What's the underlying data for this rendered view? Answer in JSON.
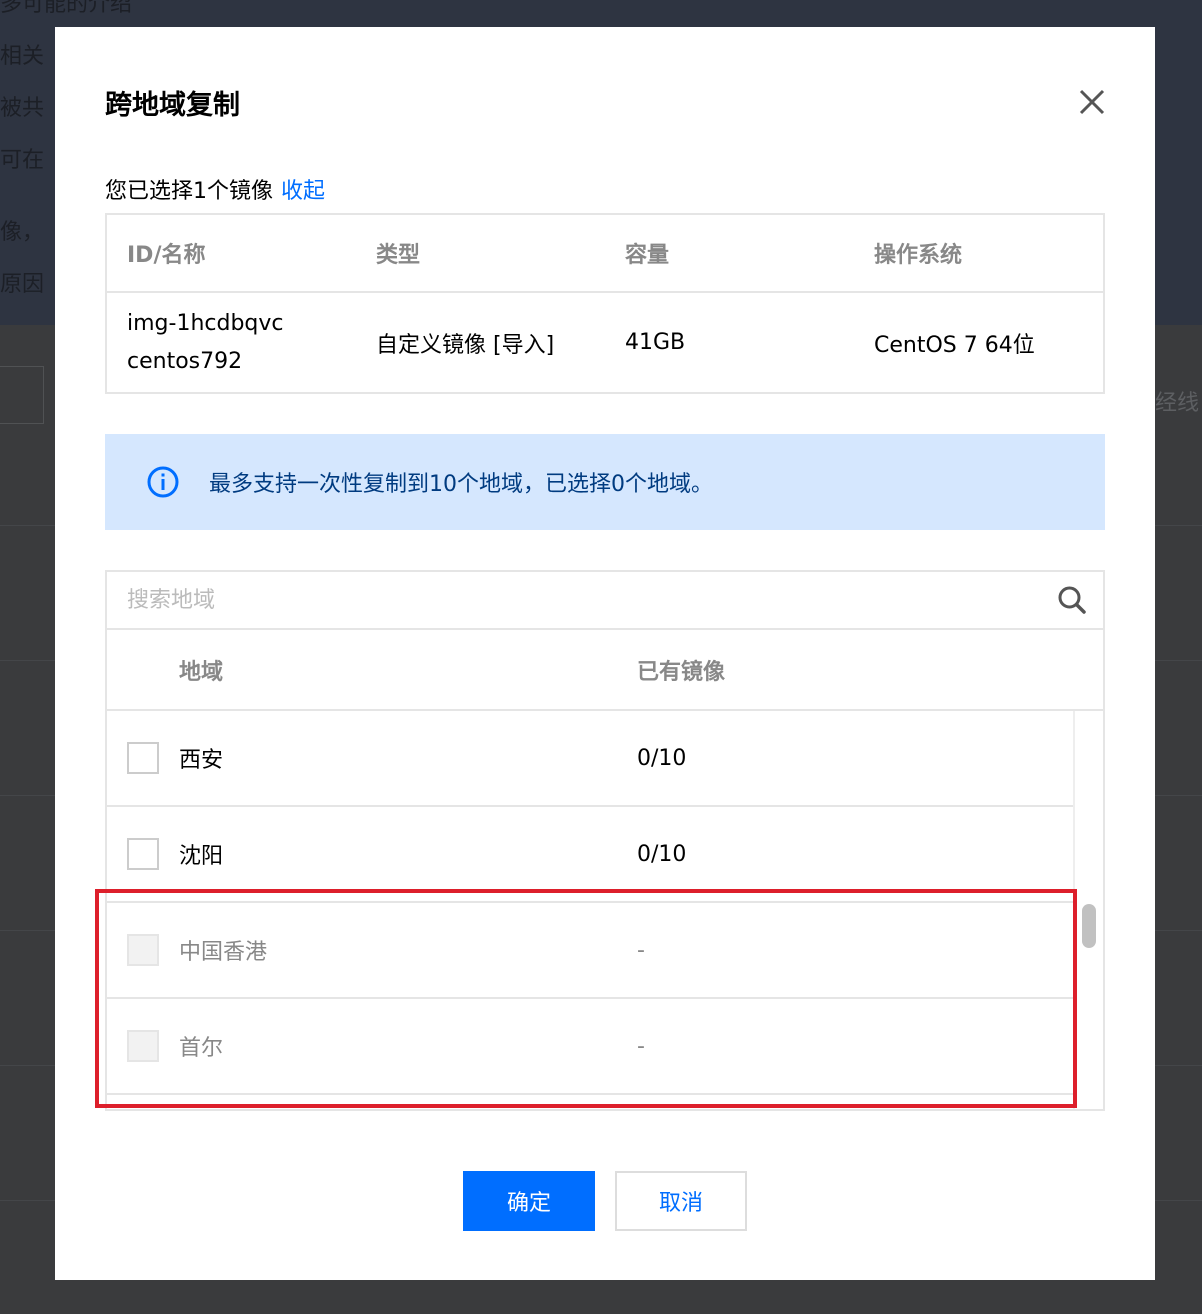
{
  "background": {
    "texts": [
      "多可能的介绍",
      "相关",
      "被共",
      "可在",
      "像，",
      "原因"
    ],
    "right_text": "经线"
  },
  "modal": {
    "title": "跨地域复制",
    "selected_prefix": "您已选择1个镜像",
    "collapse_link": "收起",
    "image_table": {
      "headers": [
        "ID/名称",
        "类型",
        "容量",
        "操作系统"
      ],
      "row": {
        "id": "img-1hcdbqvc",
        "name": "centos792",
        "type": "自定义镜像 [导入]",
        "size": "41GB",
        "os": "CentOS 7 64位"
      }
    },
    "notice": "最多支持一次性复制到10个地域，已选择0个地域。",
    "search": {
      "placeholder": "搜索地域"
    },
    "region_table": {
      "headers": [
        "地域",
        "已有镜像"
      ],
      "rows": [
        {
          "region": "西安",
          "count": "0/10",
          "disabled": false
        },
        {
          "region": "沈阳",
          "count": "0/10",
          "disabled": false
        },
        {
          "region": "中国香港",
          "count": "-",
          "disabled": true
        },
        {
          "region": "首尔",
          "count": "-",
          "disabled": true
        }
      ]
    },
    "buttons": {
      "ok": "确定",
      "cancel": "取消"
    }
  },
  "colors": {
    "link": "#006eff",
    "notice_bg": "#d5e7fe",
    "highlight": "#dd1f2b",
    "primary_button": "#006eff"
  },
  "icons": [
    "close-icon",
    "info-icon",
    "search-icon"
  ]
}
